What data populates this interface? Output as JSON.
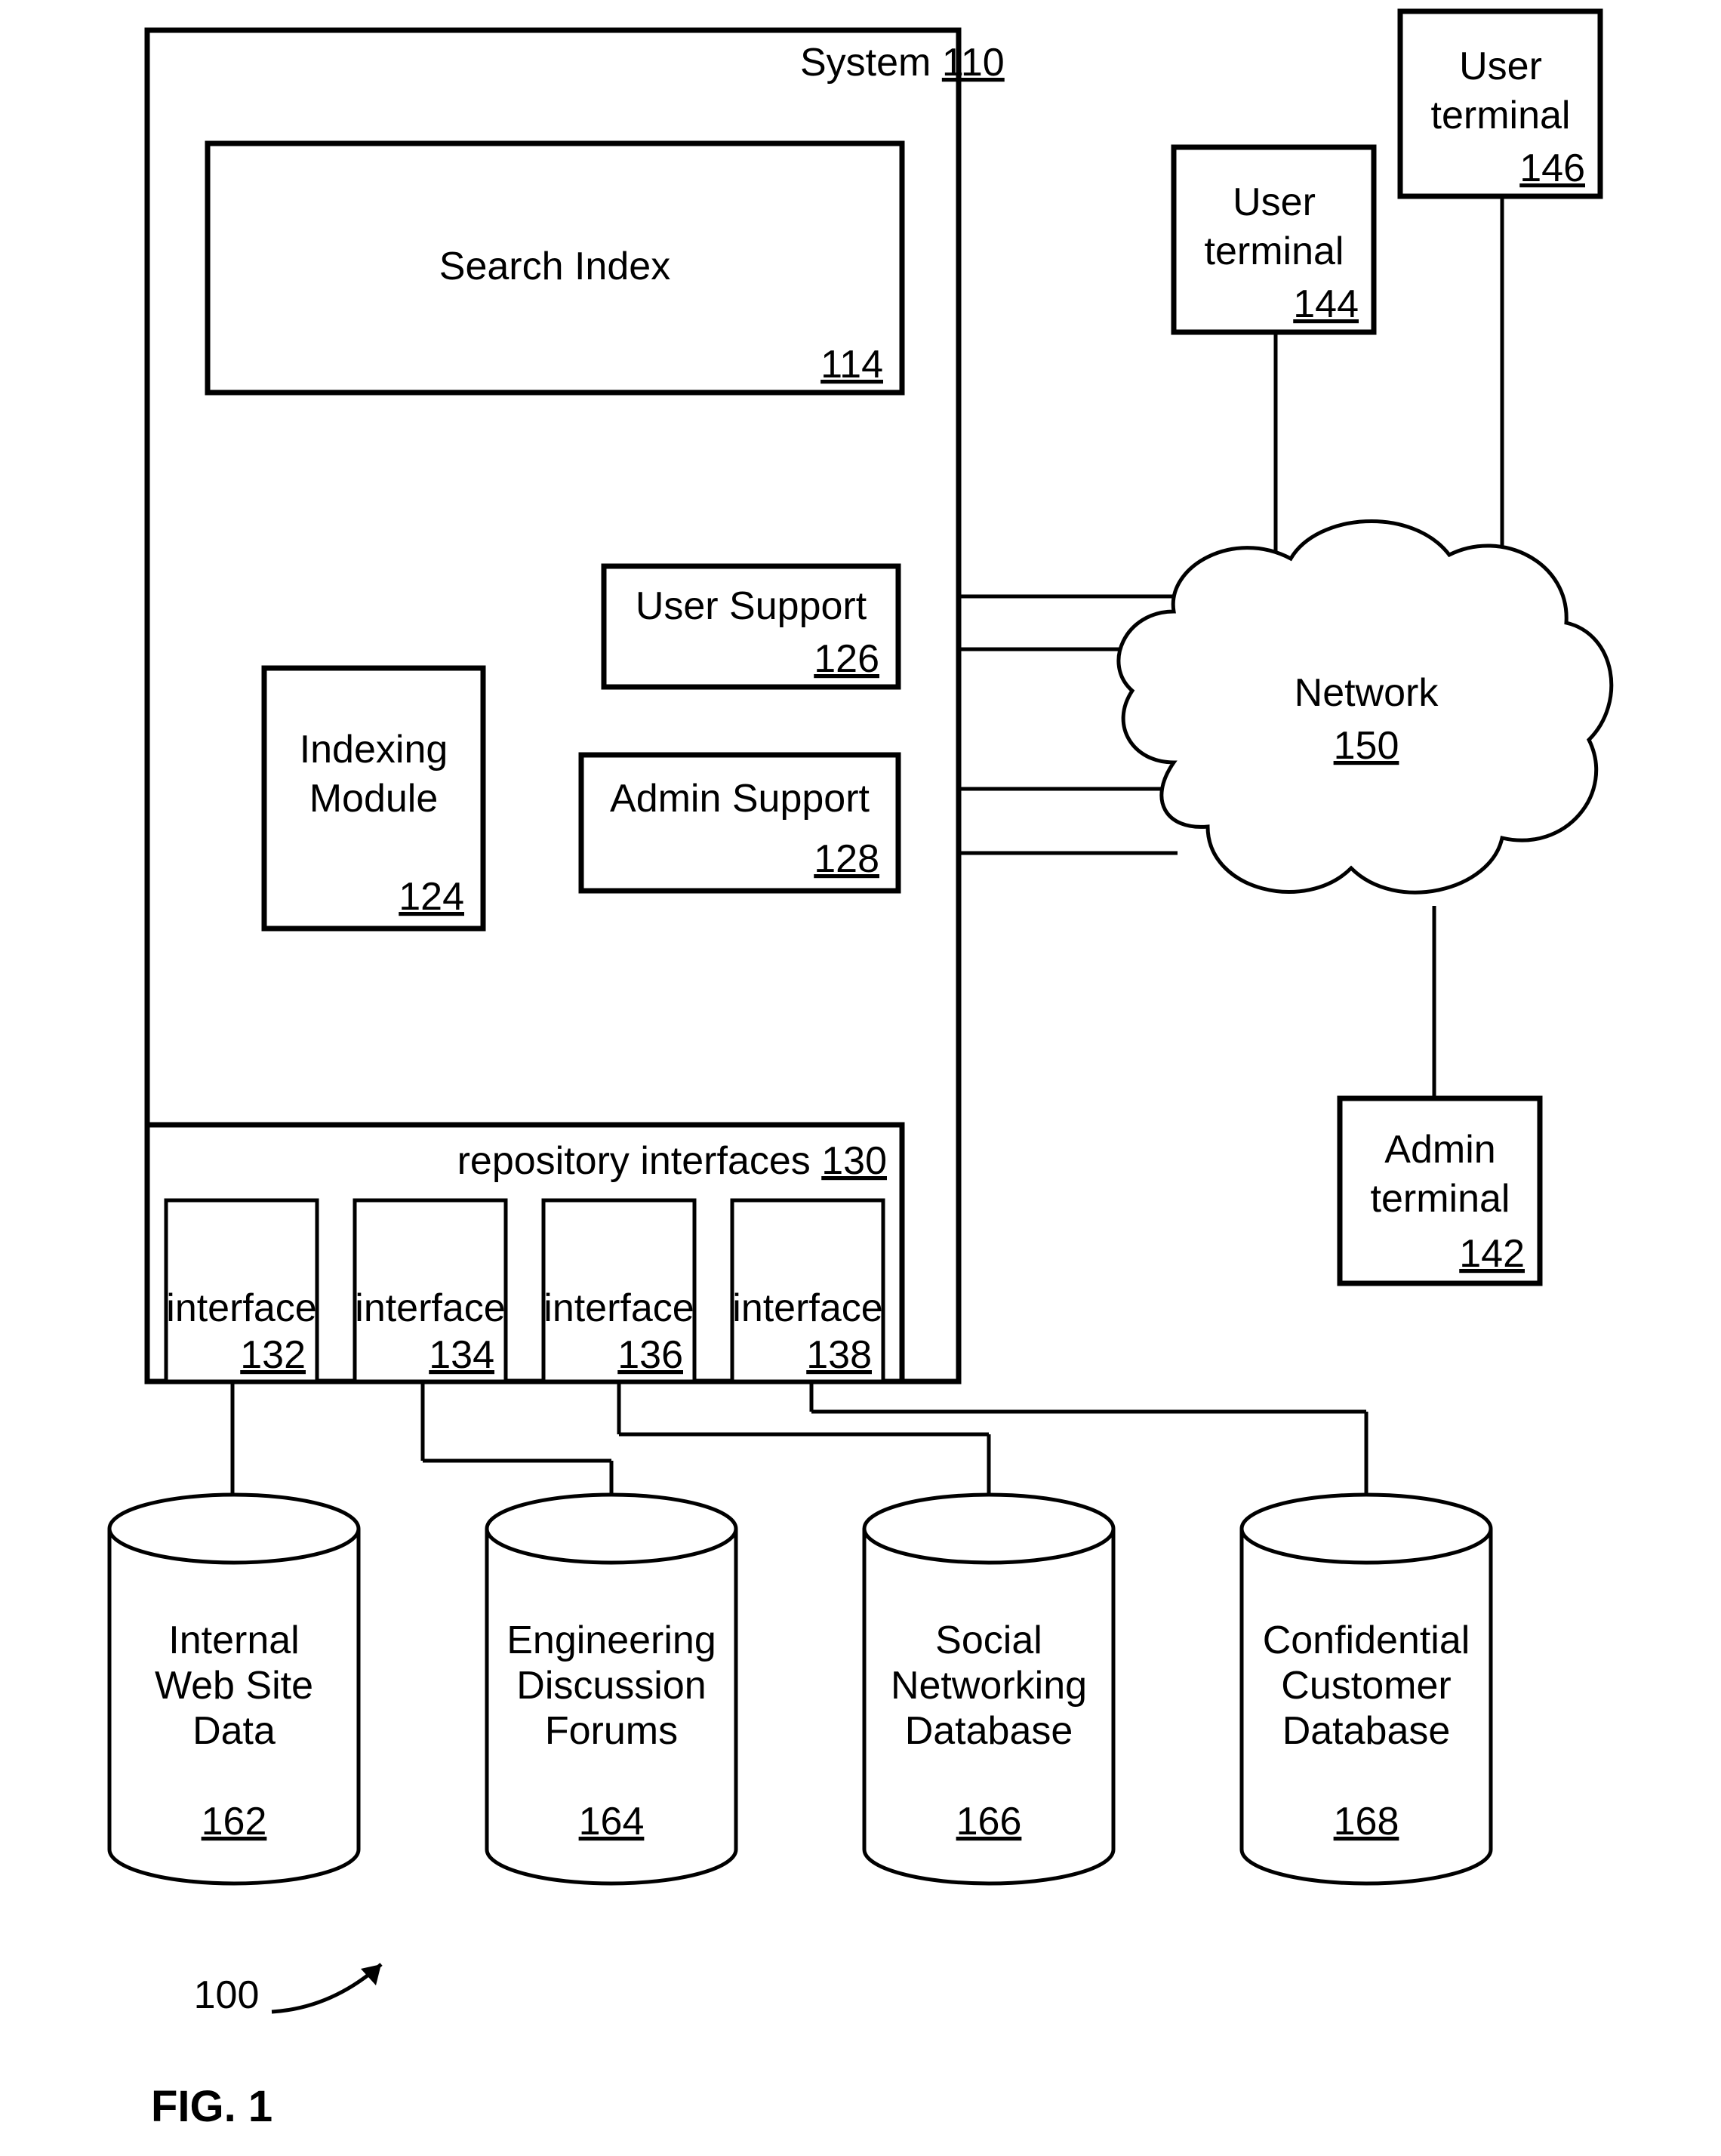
{
  "figure": {
    "caption": "FIG. 1",
    "ref": "100"
  },
  "system": {
    "label": "System",
    "ref": "110"
  },
  "search_index": {
    "label": "Search Index",
    "ref": "114"
  },
  "indexing_module": {
    "label_l1": "Indexing",
    "label_l2": "Module",
    "ref": "124"
  },
  "user_support": {
    "label": "User Support",
    "ref": "126"
  },
  "admin_support": {
    "label": "Admin Support",
    "ref": "128"
  },
  "repo_interfaces": {
    "label": "repository interfaces",
    "ref": "130"
  },
  "interfaces": [
    {
      "label": "interface",
      "ref": "132"
    },
    {
      "label": "interface",
      "ref": "134"
    },
    {
      "label": "interface",
      "ref": "136"
    },
    {
      "label": "interface",
      "ref": "138"
    }
  ],
  "user_terminal_1": {
    "label_l1": "User",
    "label_l2": "terminal",
    "ref": "144"
  },
  "user_terminal_2": {
    "label_l1": "User",
    "label_l2": "terminal",
    "ref": "146"
  },
  "admin_terminal": {
    "label_l1": "Admin",
    "label_l2": "terminal",
    "ref": "142"
  },
  "network": {
    "label": "Network",
    "ref": "150"
  },
  "databases": [
    {
      "l1": "Internal",
      "l2": "Web Site",
      "l3": "Data",
      "ref": "162"
    },
    {
      "l1": "Engineering",
      "l2": "Discussion",
      "l3": "Forums",
      "ref": "164"
    },
    {
      "l1": "Social",
      "l2": "Networking",
      "l3": "Database",
      "ref": "166"
    },
    {
      "l1": "Confidential",
      "l2": "Customer",
      "l3": "Database",
      "ref": "168"
    }
  ]
}
